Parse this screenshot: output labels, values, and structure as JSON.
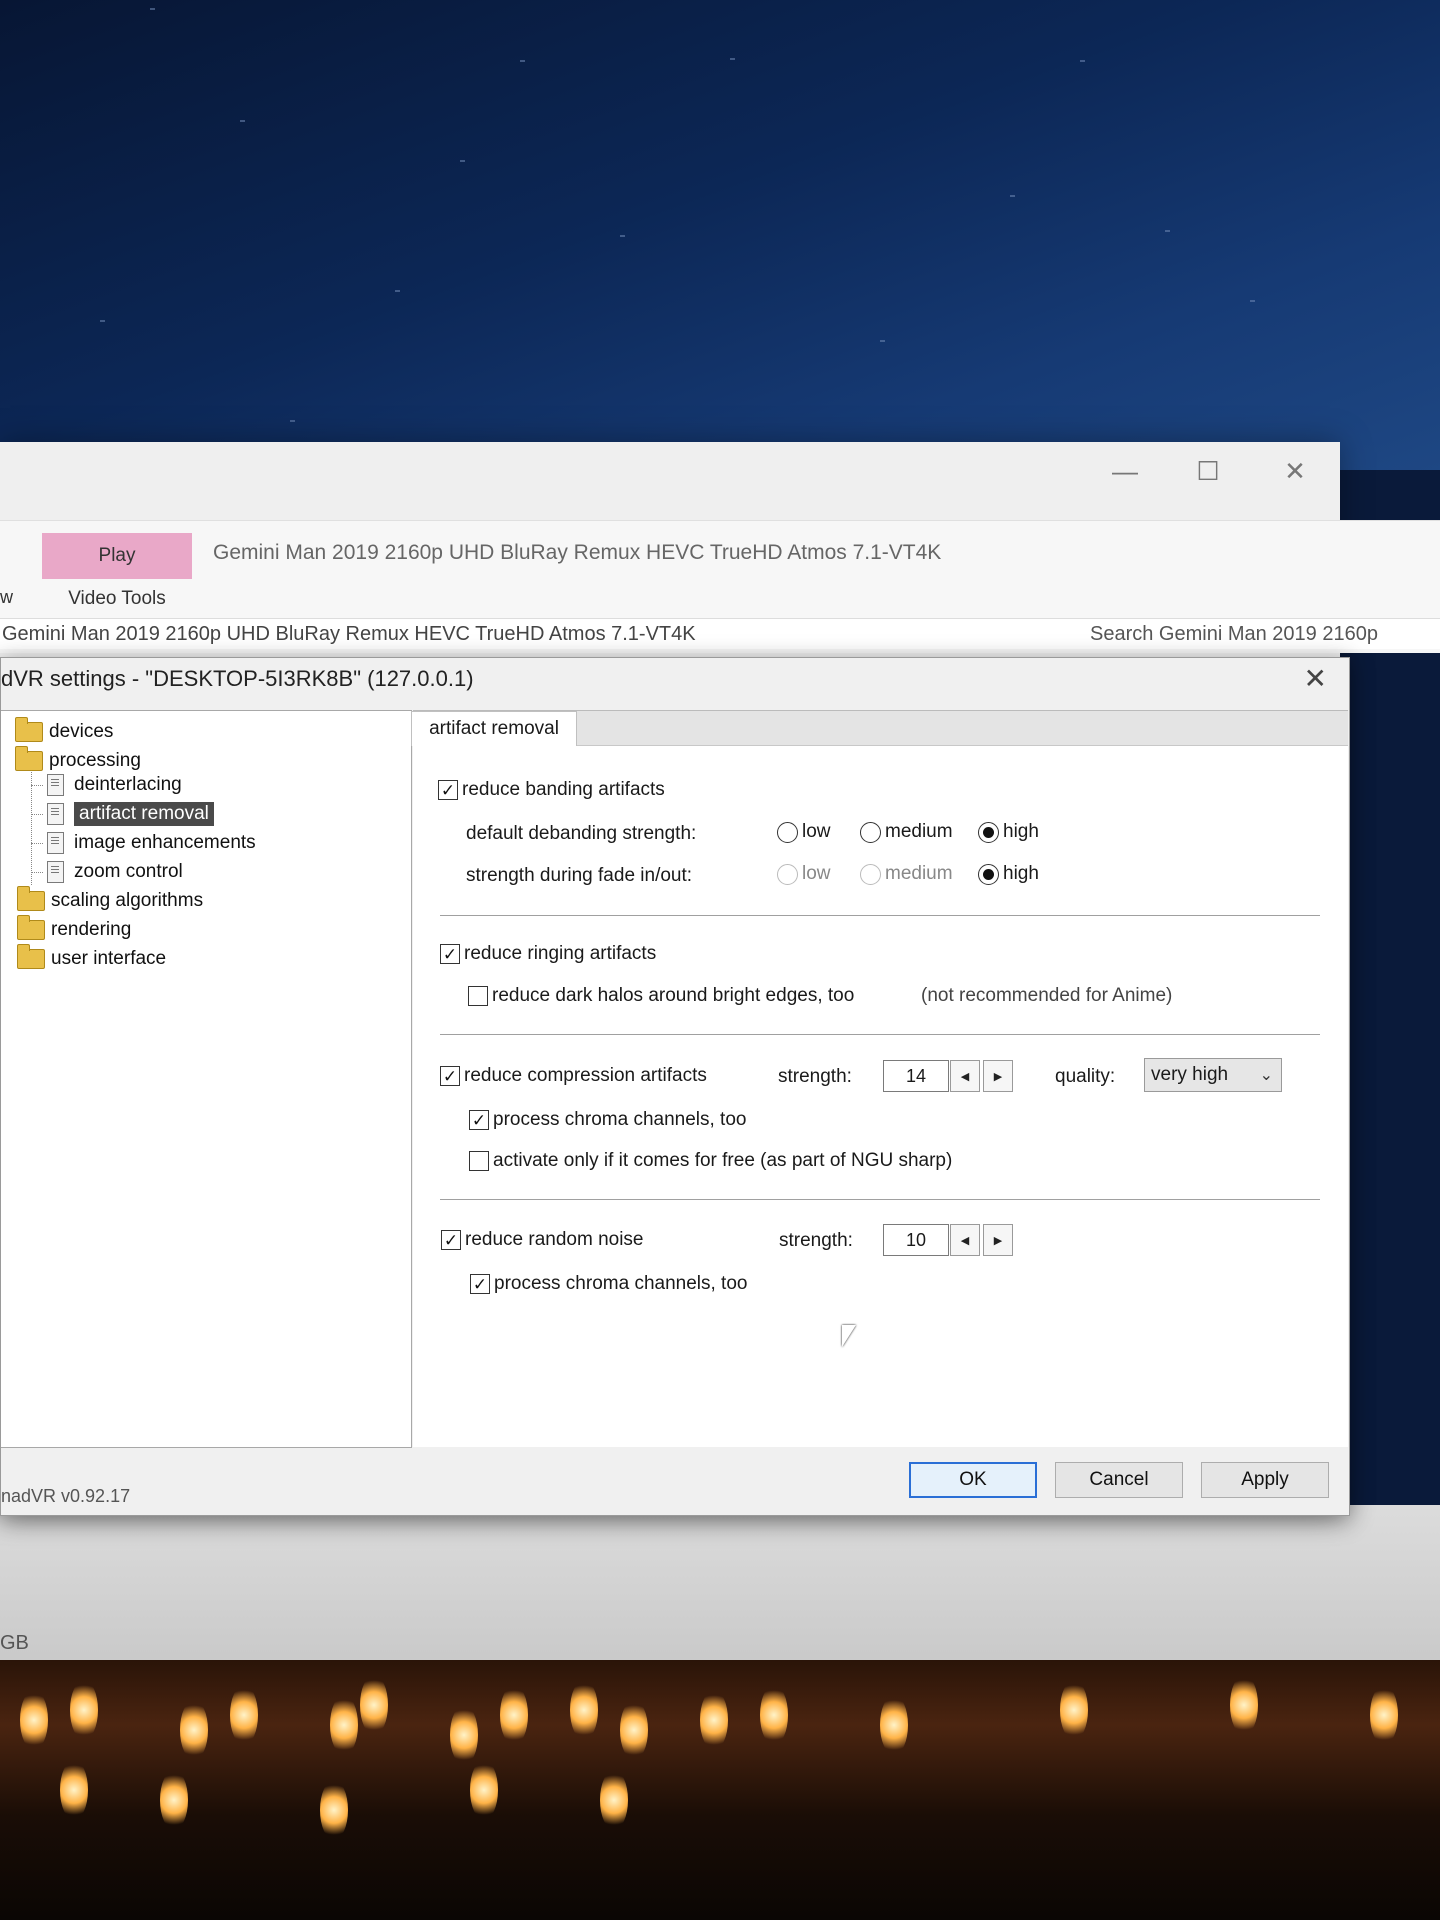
{
  "explorer": {
    "w_tab": "w",
    "play_tab": "Play",
    "video_tools_tab": "Video Tools",
    "title": "Gemini Man 2019 2160p UHD BluRay Remux HEVC TrueHD Atmos 7.1-VT4K",
    "address": "Gemini Man 2019 2160p UHD BluRay Remux HEVC TrueHD Atmos 7.1-VT4K",
    "search_placeholder": "Search Gemini Man 2019 2160p",
    "status_left": "GB"
  },
  "dialog": {
    "title": "dVR settings - \"DESKTOP-5I3RK8B\" (127.0.0.1)",
    "close_glyph": "✕",
    "version": "nadVR v0.92.17",
    "buttons": {
      "ok": "OK",
      "cancel": "Cancel",
      "apply": "Apply"
    }
  },
  "tree": [
    {
      "label": "devices",
      "type": "folder"
    },
    {
      "label": "processing",
      "type": "folder"
    },
    {
      "label": "deinterlacing",
      "type": "page"
    },
    {
      "label": "artifact removal",
      "type": "page",
      "selected": true
    },
    {
      "label": "image enhancements",
      "type": "page"
    },
    {
      "label": "zoom control",
      "type": "page"
    },
    {
      "label": "scaling algorithms",
      "type": "folder"
    },
    {
      "label": "rendering",
      "type": "folder"
    },
    {
      "label": "user interface",
      "type": "folder"
    }
  ],
  "panel": {
    "tab": "artifact removal",
    "banding": {
      "label": "reduce banding artifacts",
      "checked": true,
      "default_strength_label": "default debanding strength:",
      "fade_strength_label": "strength during fade in/out:",
      "options": [
        "low",
        "medium",
        "high"
      ],
      "default_selected": "high",
      "fade_selected": "high"
    },
    "ringing": {
      "label": "reduce ringing artifacts",
      "checked": true,
      "dark_halos_label": "reduce dark halos around bright edges, too",
      "dark_halos_checked": false,
      "note": "(not recommended for Anime)"
    },
    "compression": {
      "label": "reduce compression artifacts",
      "checked": true,
      "strength_label": "strength:",
      "strength": "14",
      "quality_label": "quality:",
      "quality": "very high",
      "chroma_label": "process chroma channels, too",
      "chroma_checked": true,
      "free_label": "activate only if it comes for free (as part of NGU sharp)",
      "free_checked": false
    },
    "noise": {
      "label": "reduce random noise",
      "checked": true,
      "strength_label": "strength:",
      "strength": "10",
      "chroma_label": "process chroma channels, too",
      "chroma_checked": true
    }
  },
  "icons": {
    "check": "✓",
    "spin_left": "◀",
    "spin_right": "▶",
    "chevron": "⌄",
    "minimize": "—",
    "maximize": "☐",
    "close": "✕"
  }
}
